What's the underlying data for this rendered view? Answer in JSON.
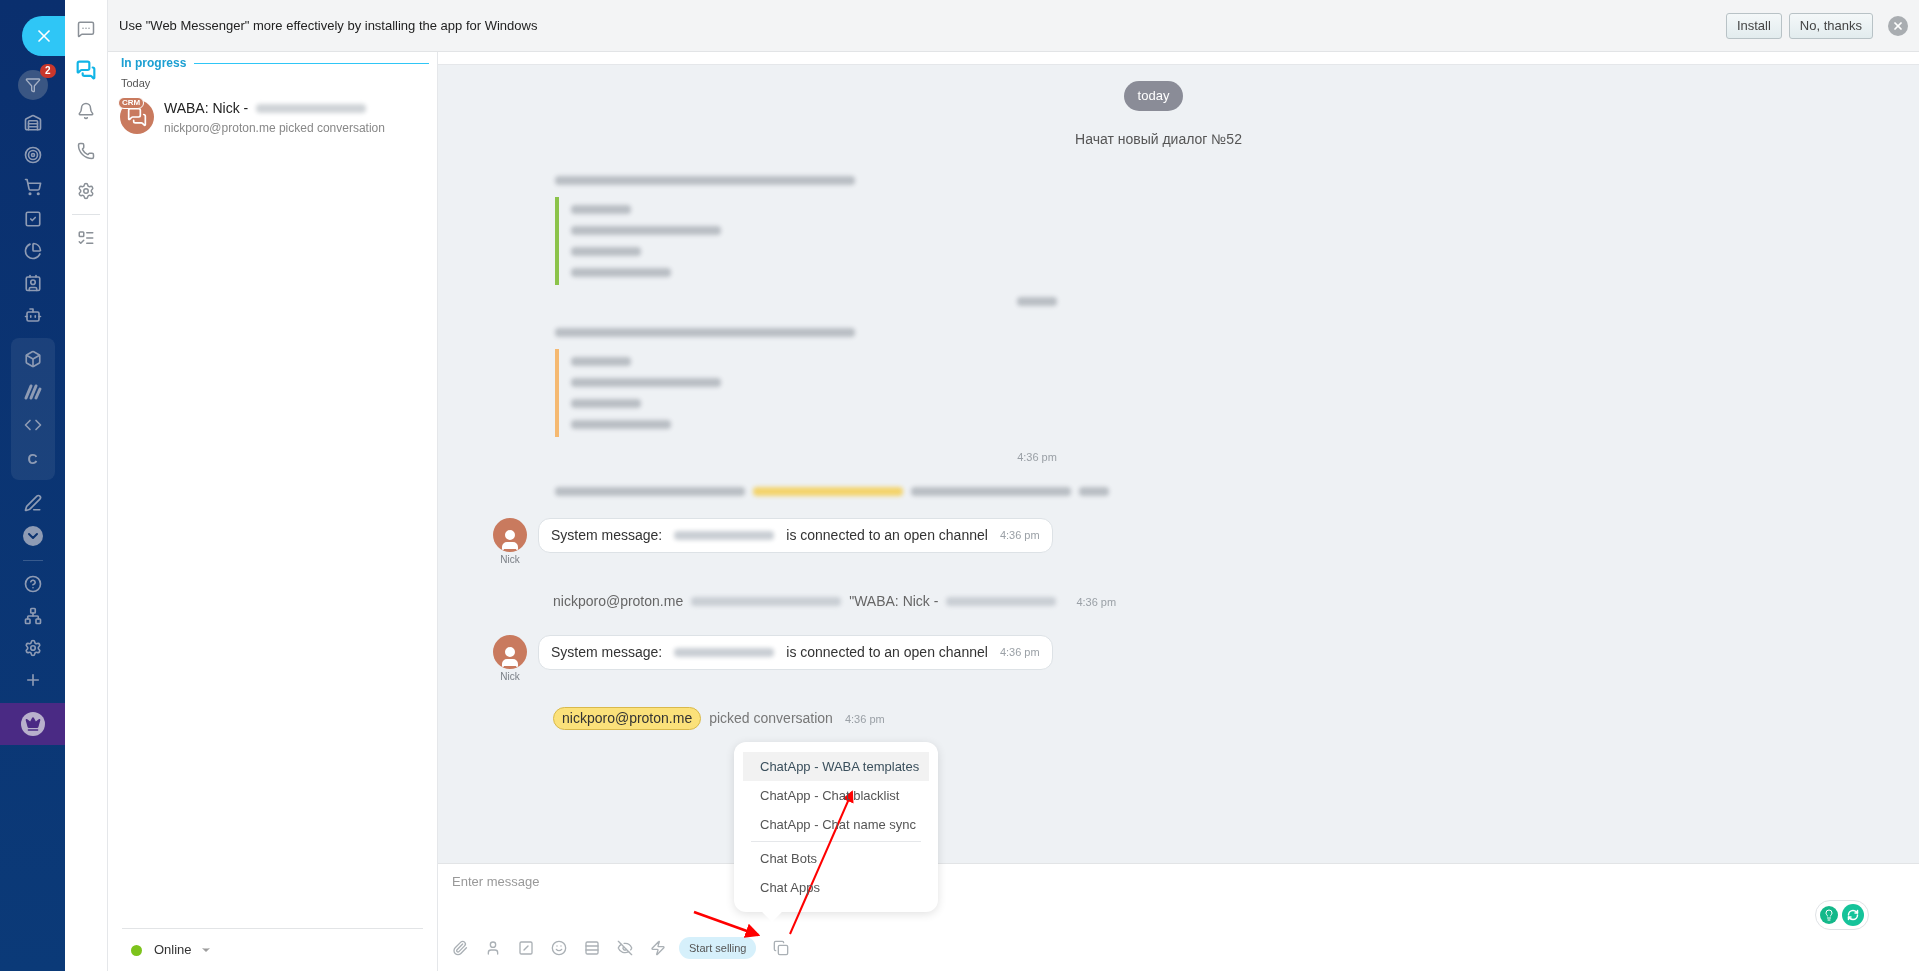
{
  "nav_rail": {
    "badge": "2",
    "letter_item": "C"
  },
  "icon_tabs": [
    {
      "kind": "messages",
      "selected": false
    },
    {
      "kind": "openlines",
      "selected": true
    },
    {
      "kind": "notifications",
      "selected": false
    },
    {
      "kind": "calls",
      "selected": false
    },
    {
      "kind": "settings",
      "selected": false
    },
    {
      "kind": "tasks",
      "selected": false
    }
  ],
  "banner": {
    "text": "Use \"Web Messenger\" more effectively by installing the app for Windows",
    "buttons": [
      "Install",
      "No, thanks"
    ]
  },
  "chat_list": {
    "section": "In progress",
    "group": "Today",
    "items": [
      {
        "badge": "CRM",
        "title": "WABA: Nick -",
        "subtitle": "nickporo@proton.me picked conversation"
      }
    ],
    "status": {
      "label": "Online",
      "online": true
    }
  },
  "chat": {
    "date_pill": "today",
    "header_line": "Начат новый диалог №52",
    "messages": [
      {
        "kind": "blurred_card",
        "color": "#8bc34a"
      },
      {
        "kind": "blurred_card",
        "color": "#f5b971",
        "time": "4:36 pm"
      },
      {
        "kind": "blurred_line"
      },
      {
        "kind": "system",
        "author": "Nick",
        "prefix": "System message:",
        "suffix": "is connected to an open channel",
        "time": "4:36 pm"
      },
      {
        "kind": "event",
        "actor": "nickporo@proton.me",
        "quote": "\"WABA: Nick -",
        "time": "4:36 pm"
      },
      {
        "kind": "system",
        "author": "Nick",
        "prefix": "System message:",
        "suffix": "is connected to an open channel",
        "time": "4:36 pm"
      },
      {
        "kind": "picked",
        "actor": "nickporo@proton.me",
        "text": "picked conversation",
        "time": "4:36 pm"
      }
    ]
  },
  "menu": {
    "groups": [
      [
        {
          "label": "ChatApp - WABA templates",
          "selected": true
        },
        {
          "label": "ChatApp - Chat blacklist",
          "selected": false
        },
        {
          "label": "ChatApp - Chat name sync",
          "selected": false
        }
      ],
      [
        {
          "label": "Chat Bots",
          "selected": false
        },
        {
          "label": "Chat Apps",
          "selected": false
        }
      ]
    ]
  },
  "composer": {
    "placeholder": "Enter message",
    "start_selling": "Start selling"
  }
}
